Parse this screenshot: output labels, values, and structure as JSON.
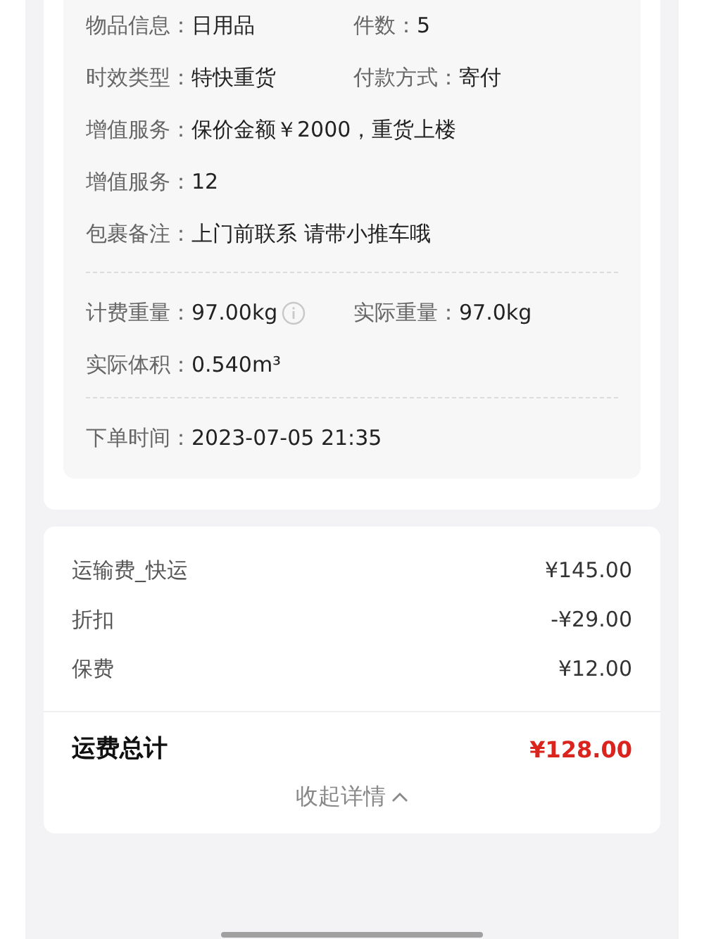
{
  "details": {
    "groups": [
      {
        "rows": [
          [
            {
              "label": "物品信息：",
              "value": "日用品"
            },
            {
              "label": "件数：",
              "value": "5"
            }
          ],
          [
            {
              "label": "时效类型：",
              "value": "特快重货"
            },
            {
              "label": "付款方式：",
              "value": "寄付"
            }
          ],
          [
            {
              "label": "增值服务：",
              "value": "保价金额￥2000，重货上楼"
            }
          ],
          [
            {
              "label": "增值服务：",
              "value": "12"
            }
          ],
          [
            {
              "label": "包裹备注：",
              "value": "上门前联系 请带小推车哦"
            }
          ]
        ]
      },
      {
        "rows": [
          [
            {
              "label": "计费重量：",
              "value": "97.00kg",
              "info": true
            },
            {
              "label": "实际重量：",
              "value": "97.0kg"
            }
          ],
          [
            {
              "label": "实际体积：",
              "value": "0.540m³"
            }
          ]
        ]
      },
      {
        "rows": [
          [
            {
              "label": "下单时间：",
              "value": "2023-07-05 21:35"
            }
          ]
        ]
      }
    ]
  },
  "fees": {
    "items": [
      {
        "name": "运输费_快运",
        "amount": "¥145.00"
      },
      {
        "name": "折扣",
        "amount": "-¥29.00"
      },
      {
        "name": "保费",
        "amount": "¥12.00"
      }
    ],
    "total": {
      "label": "运费总计",
      "amount": "¥128.00"
    },
    "toggle": {
      "label": "收起详情",
      "expanded": true
    }
  }
}
